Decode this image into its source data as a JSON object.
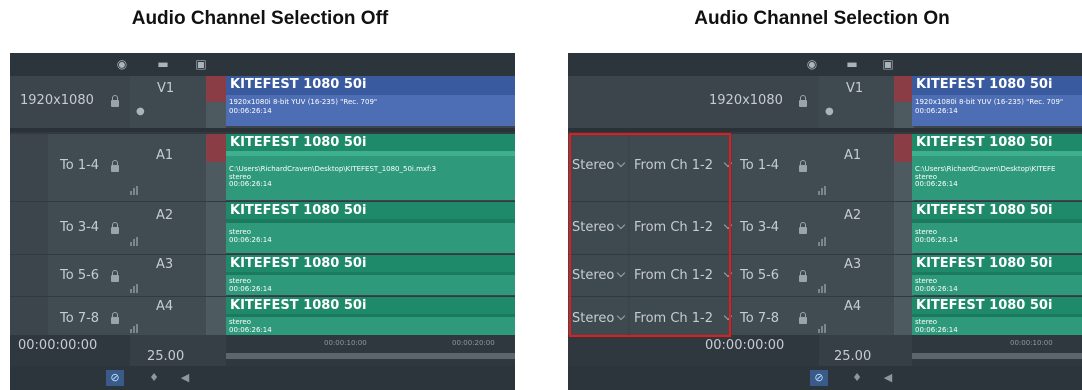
{
  "captions": {
    "off": "Audio Channel Selection Off",
    "on": "Audio Channel Selection On"
  },
  "header_icons": [
    "eye-icon",
    "monitor-icon",
    "film-icon"
  ],
  "video_track": {
    "resolution": "1920x1080",
    "name": "V1",
    "clip": {
      "title": "KITEFEST 1080 50i",
      "format": "1920x1080i 8-bit YUV (16-235) \"Rec. 709\"",
      "duration": "00:06:26:14"
    }
  },
  "audio_tracks": [
    {
      "route": "To 1-4",
      "name": "A1",
      "mode": "Stereo",
      "source": "From Ch 1-2",
      "clip": {
        "title": "KITEFEST 1080 50i",
        "path": "C:\\Users\\RichardCraven\\Desktop\\KITEFEST_1080_50i.mxf:3",
        "path_truncated": "C:\\Users\\RichardCraven\\Desktop\\KITEFE",
        "type": "stereo",
        "duration": "00:06:26:14"
      }
    },
    {
      "route": "To 3-4",
      "name": "A2",
      "mode": "Stereo",
      "source": "From Ch 1-2",
      "clip": {
        "title": "KITEFEST 1080 50i",
        "type": "stereo",
        "duration": "00:06:26:14"
      }
    },
    {
      "route": "To 5-6",
      "name": "A3",
      "mode": "Stereo",
      "source": "From Ch 1-2",
      "clip": {
        "title": "KITEFEST 1080 50i",
        "type": "stereo",
        "duration": "00:06:26:14"
      }
    },
    {
      "route": "To 7-8",
      "name": "A4",
      "mode": "Stereo",
      "source": "From Ch 1-2",
      "clip": {
        "title": "KITEFEST 1080 50i",
        "type": "stereo",
        "duration": "00:06:26:14"
      }
    }
  ],
  "timeline": {
    "timecode": "00:00:00:00",
    "frame_rate": "25.00",
    "ruler_marks": [
      "00:00:10:00",
      "00:00:20:00"
    ]
  },
  "bottom_tools": [
    "hide-icon",
    "marker-icon",
    "speaker-icon"
  ],
  "colors": {
    "video_clip": "#4d6eb5",
    "audio_clip": "#2e9a7b",
    "audio_clip_header": "#1e8a6a",
    "highlight_box": "#e31b1b"
  }
}
